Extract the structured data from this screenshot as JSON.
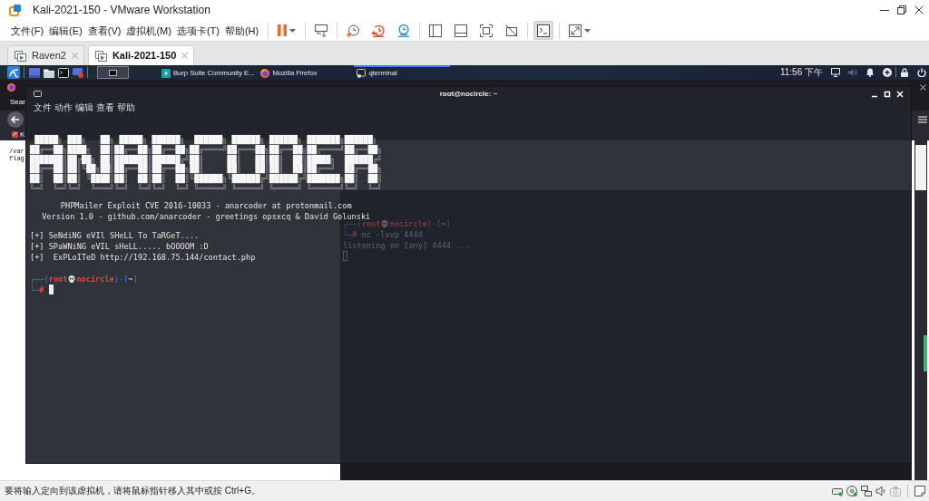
{
  "window": {
    "title": "Kali-2021-150 - VMware Workstation"
  },
  "menu": [
    "文件(F)",
    "编辑(E)",
    "查看(V)",
    "虚拟机(M)",
    "选项卡(T)",
    "帮助(H)"
  ],
  "toolbar": [
    {
      "items": [
        {
          "kind": "pause",
          "dropdown": true,
          "selected": false
        }
      ]
    },
    {
      "items": [
        {
          "kind": "send_keys",
          "dropdown": false,
          "selected": false
        }
      ]
    },
    {
      "items": [
        {
          "kind": "snapshot",
          "dropdown": false,
          "selected": false
        },
        {
          "kind": "revert",
          "dropdown": false,
          "selected": false
        },
        {
          "kind": "snapshot_manager",
          "dropdown": false,
          "selected": false
        }
      ]
    },
    {
      "items": [
        {
          "kind": "library",
          "dropdown": false,
          "selected": false
        },
        {
          "kind": "thumbnails",
          "dropdown": false,
          "selected": false
        },
        {
          "kind": "full_screen",
          "dropdown": false,
          "selected": false
        },
        {
          "kind": "unity",
          "dropdown": false,
          "selected": false
        }
      ]
    },
    {
      "items": [
        {
          "kind": "console",
          "dropdown": false,
          "selected": true
        }
      ]
    },
    {
      "items": [
        {
          "kind": "stretch",
          "dropdown": true,
          "selected": false
        }
      ]
    }
  ],
  "tabs": [
    {
      "label": "Raven2",
      "selected": false
    },
    {
      "label": "Kali-2021-150",
      "selected": true
    }
  ],
  "guest": {
    "panel": {
      "launchers": [
        {
          "kind": "desktop"
        },
        {
          "kind": "files"
        },
        {
          "kind": "terminal"
        },
        {
          "kind": "recorder"
        }
      ],
      "workspaces": [
        {
          "selected": true
        }
      ],
      "tasks": [
        {
          "kind": "burp",
          "label": "Burp Suite Community E...",
          "selected": false
        },
        {
          "kind": "browser",
          "label": "Mozilla Firefox",
          "selected": false
        },
        {
          "kind": "terminal",
          "label": "qterminal",
          "selected": true
        }
      ],
      "clock": "11:56 下午",
      "tray": [
        [
          {
            "kind": "display",
            "disabled": false
          },
          {
            "kind": "volume",
            "disabled": true
          },
          {
            "kind": "notifications",
            "disabled": false
          },
          {
            "kind": "add",
            "disabled": false
          }
        ],
        [
          {
            "kind": "lock",
            "disabled": false
          },
          {
            "kind": "power",
            "disabled": false
          }
        ]
      ]
    },
    "browser": {
      "tab": "Sear",
      "bookmark": "K",
      "page_lines": [
        "/var",
        "flag"
      ]
    },
    "background_terminal": {
      "focused": false,
      "prompt": {
        "open": "┌──(",
        "user": "root",
        "host": "nocircle",
        "mid": ")-[",
        "dir": "~",
        "close": "]",
        "branch": "└─",
        "symbol": "#"
      },
      "command": "nc -lvvp 4444",
      "output": [
        "listening on [any] 4444 ..."
      ]
    },
    "terminal": {
      "title": "root@nocircle: ~",
      "focused": true,
      "menu": [
        "文件",
        "动作",
        "编辑",
        "查看",
        "帮助"
      ],
      "banner": [
        " █████╗ ███╗   ██╗ █████╗ ██████╗  ██████╗ ██████╗ ██████╗ ███████╗██████╗",
        "██╔══██╗████╗  ██║██╔══██╗██╔══██╗██╔════╝██╔═══██╗██╔══██╗██╔════╝██╔══██╗",
        "███████║██╔██╗ ██║███████║██████╔╝██║     ██║   ██║██║  ██║█████╗  ██████╔╝",
        "██╔══██║██║╚██╗██║██╔══██║██╔══██╗██║     ██║   ██║██║  ██║██╔══╝  ██╔══██╗",
        "██║  ██║██║ ╚████║██║  ██║██║  ██║╚██████╗╚██████╔╝██████╔╝███████╗██║  ██║",
        "╚═╝  ╚═╝╚═╝  ╚═══╝╚═╝  ╚═╝╚═╝  ╚═╝ ╚═════╝ ╚═════╝ ╚═════╝ ╚══════╝╚═╝  ╚═╝"
      ],
      "subtitle": [
        "PHPMailer Exploit CVE 2016-10033 - anarcoder at protonmail.com",
        "Version 1.0 - github.com/anarcoder - greetings opsxcq & David Golunski"
      ],
      "output": [
        "[+] SeNdiNG eVIl SHeLL To TaRGeT....",
        "[+] SPaWNiNG eVIL sHeLL..... bOOOOM :D",
        "[+]  ExPLoITeD http://192.168.75.144/contact.php"
      ],
      "prompt": {
        "open": "┌──(",
        "user": "root",
        "host": "nocircle",
        "mid": ")-[",
        "dir": "~",
        "close": "]",
        "branch": "└─",
        "symbol": "#"
      }
    }
  },
  "status_bar": {
    "message": "要将输入定向到该虚拟机，请将鼠标指针移入其中或按 Ctrl+G。",
    "devices": [
      [
        {
          "kind": "disk",
          "disabled": false
        },
        {
          "kind": "disc",
          "disabled": false
        },
        {
          "kind": "network",
          "disabled": false
        },
        {
          "kind": "sound",
          "disabled": false
        },
        {
          "kind": "camera",
          "disabled": true
        }
      ],
      [
        {
          "kind": "message",
          "disabled": false
        }
      ]
    ]
  }
}
